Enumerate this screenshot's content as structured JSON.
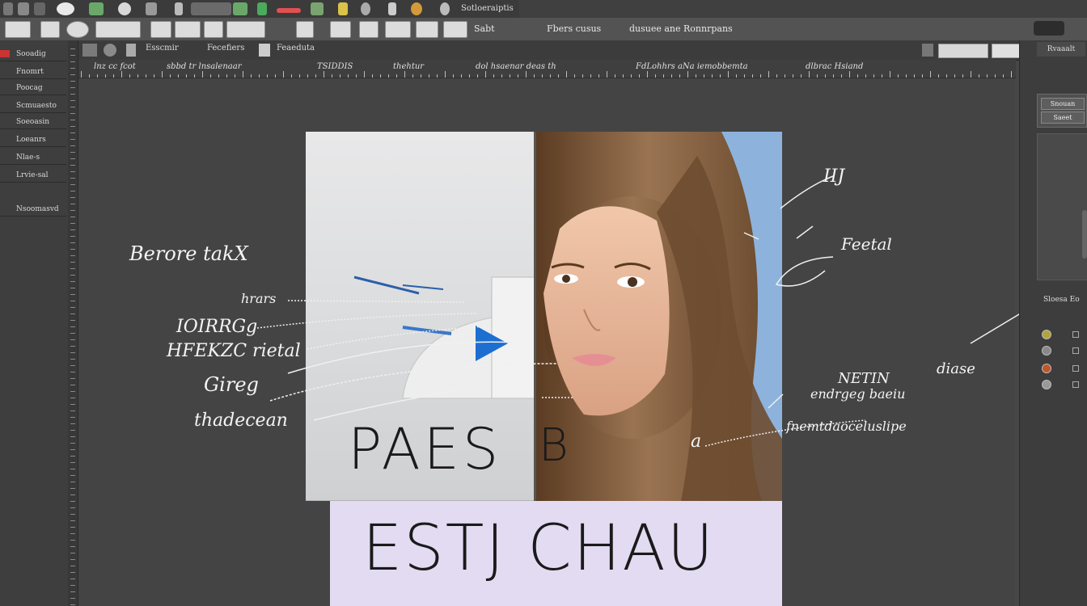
{
  "menubar": {
    "title_text": "Sotloeraiptis"
  },
  "options_bar": {
    "field_labels": [
      "Sabt",
      "Fbers cusus",
      "dusuee ane Ronnrpans"
    ]
  },
  "tabs": {
    "items": [
      "Esscmir",
      "Fecefiers",
      "Feaeduta"
    ]
  },
  "ruler": {
    "labels": [
      "lnz cc fcot",
      "sbbd tr lnsalenaar",
      "TSIDDIS",
      "thehtur",
      "dol hsaenar deas th",
      "FdLohhrs aNa iemobbemta",
      "dlbrac Hsiand"
    ]
  },
  "left_panel": {
    "rows": [
      "Sooadig",
      "Fnomrt",
      "Poocag",
      "Scmuaesto",
      "Soeoasin",
      "Loeanrs",
      "Nlae-s",
      "Lrvie-sal",
      "Nsoomasvd"
    ]
  },
  "right_panel": {
    "header": "Rvaaalt",
    "buttons": [
      "Snouan",
      "Saeet"
    ],
    "layers_label": "Sloesa Eo"
  },
  "annotations": {
    "before_label": "Berore takX",
    "left": [
      "hrars",
      "IOIRRGg",
      "HFEKZC rietal",
      "Gireg",
      "thadecean"
    ],
    "right_top": "IIJ",
    "right_feature": "Feetal",
    "right_notes": [
      "NETIN",
      "diase",
      "endrgeg baeiu",
      "fnemtdaoceluslipe"
    ],
    "b_marker": "B",
    "a_marker": "a"
  },
  "canvas": {
    "big_caption": "PAES",
    "bottom_caption": "ESTJ CHAU"
  },
  "colors": {
    "accent_blue": "#1c6fd0",
    "bottom_strip": "#e2dbf2",
    "sky": "#8db3dd"
  }
}
